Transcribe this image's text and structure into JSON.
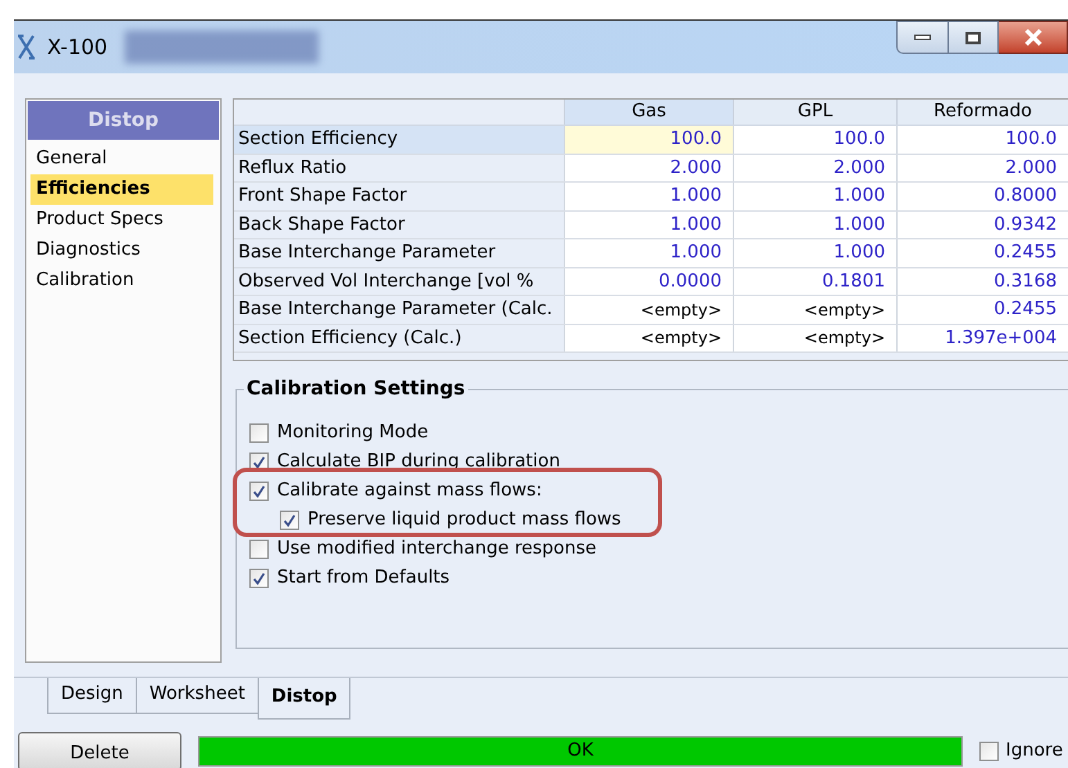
{
  "window": {
    "title": "X-100"
  },
  "sidebar": {
    "header": "Distop",
    "items": [
      {
        "label": "General",
        "selected": false
      },
      {
        "label": "Efficiencies",
        "selected": true
      },
      {
        "label": "Product Specs",
        "selected": false
      },
      {
        "label": "Diagnostics",
        "selected": false
      },
      {
        "label": "Calibration",
        "selected": false
      }
    ]
  },
  "table": {
    "columns": [
      "Gas",
      "GPL",
      "Reformado"
    ],
    "rows": [
      {
        "label": "Section Efficiency",
        "selected": true,
        "cells": [
          "100.0",
          "100.0",
          "100.0"
        ]
      },
      {
        "label": "Reflux Ratio",
        "selected": false,
        "cells": [
          "2.000",
          "2.000",
          "2.000"
        ]
      },
      {
        "label": "Front Shape Factor",
        "selected": false,
        "cells": [
          "1.000",
          "1.000",
          "0.8000"
        ]
      },
      {
        "label": "Back Shape Factor",
        "selected": false,
        "cells": [
          "1.000",
          "1.000",
          "0.9342"
        ]
      },
      {
        "label": "Base Interchange Parameter",
        "selected": false,
        "cells": [
          "1.000",
          "1.000",
          "0.2455"
        ]
      },
      {
        "label": "Observed Vol Interchange [vol %",
        "selected": false,
        "cells": [
          "0.0000",
          "0.1801",
          "0.3168"
        ]
      },
      {
        "label": "Base Interchange Parameter (Calc.",
        "selected": false,
        "cells": [
          "<empty>",
          "<empty>",
          "0.2455"
        ]
      },
      {
        "label": "Section Efficiency (Calc.)",
        "selected": false,
        "cells": [
          "<empty>",
          "<empty>",
          "1.397e+004"
        ]
      }
    ]
  },
  "calibration_settings": {
    "title": "Calibration Settings",
    "options": [
      {
        "label": "Monitoring Mode",
        "checked": false
      },
      {
        "label": "Calculate BIP during calibration",
        "checked": true
      },
      {
        "label": "Calibrate against mass flows:",
        "checked": true,
        "highlighted": true,
        "children": [
          {
            "label": "Preserve liquid product mass flows",
            "checked": true
          }
        ]
      },
      {
        "label": "Use modified interchange response",
        "checked": false
      },
      {
        "label": "Start from Defaults",
        "checked": true
      }
    ]
  },
  "tabs": [
    {
      "label": "Design",
      "selected": false
    },
    {
      "label": "Worksheet",
      "selected": false
    },
    {
      "label": "Distop",
      "selected": true
    }
  ],
  "footer": {
    "delete_button": "Delete",
    "status": "OK",
    "ignored": {
      "label": "Ignore",
      "checked": false
    }
  }
}
